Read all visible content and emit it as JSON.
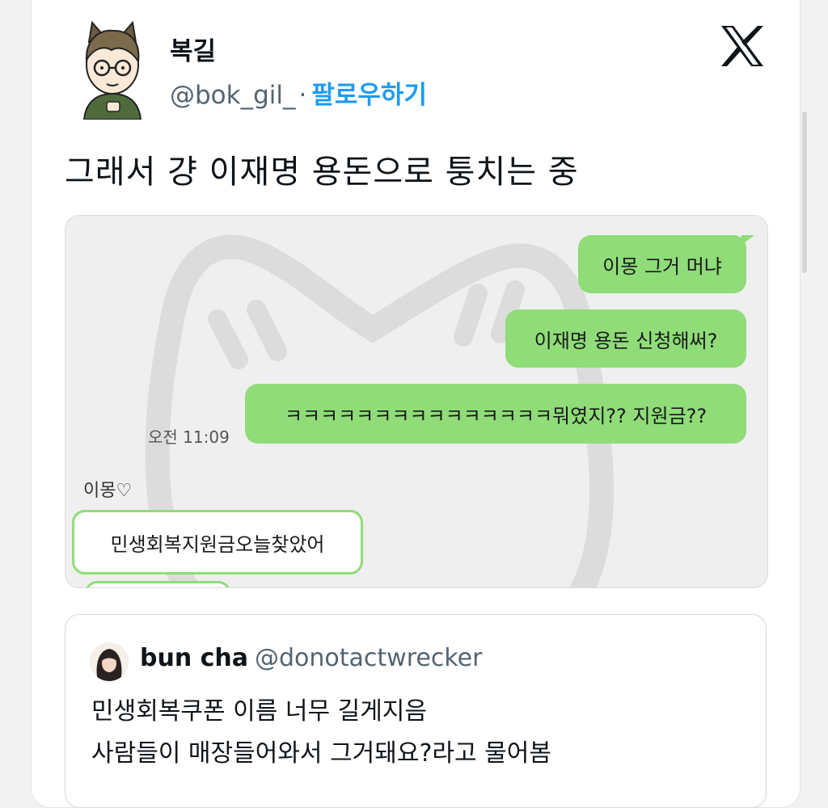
{
  "author": {
    "display_name": "복길",
    "handle": "@bok_gil_",
    "separator": "·",
    "follow_label": "팔로우하기"
  },
  "tweet": {
    "text": "그래서 걍 이재명 용돈으로 퉁치는 중"
  },
  "chat": {
    "messages_me": [
      "이몽 그거 머냐",
      "이재명 용돈 신청해써?",
      "ㅋㅋㅋㅋㅋㅋㅋㅋㅋㅋㅋㅋㅋㅋㅋ뭐였지?? 지원금??"
    ],
    "time": "오전 11:09",
    "sender_name": "이몽♡",
    "messages_other": [
      "민생회복지원금오늘찾았어"
    ]
  },
  "quoted_tweet": {
    "display_name": "bun cha",
    "handle": "@donotactwrecker",
    "lines": [
      "민생회복쿠폰 이름 너무 길게지음",
      "사람들이 매장들어와서 그거돼요?라고 물어봄"
    ]
  },
  "colors": {
    "link_blue": "#1d9bf0",
    "chat_green": "#8fdc79",
    "chat_background": "#efefef"
  },
  "icons": [
    "x-logo-icon",
    "avatar-illustration",
    "watermark-cat"
  ]
}
